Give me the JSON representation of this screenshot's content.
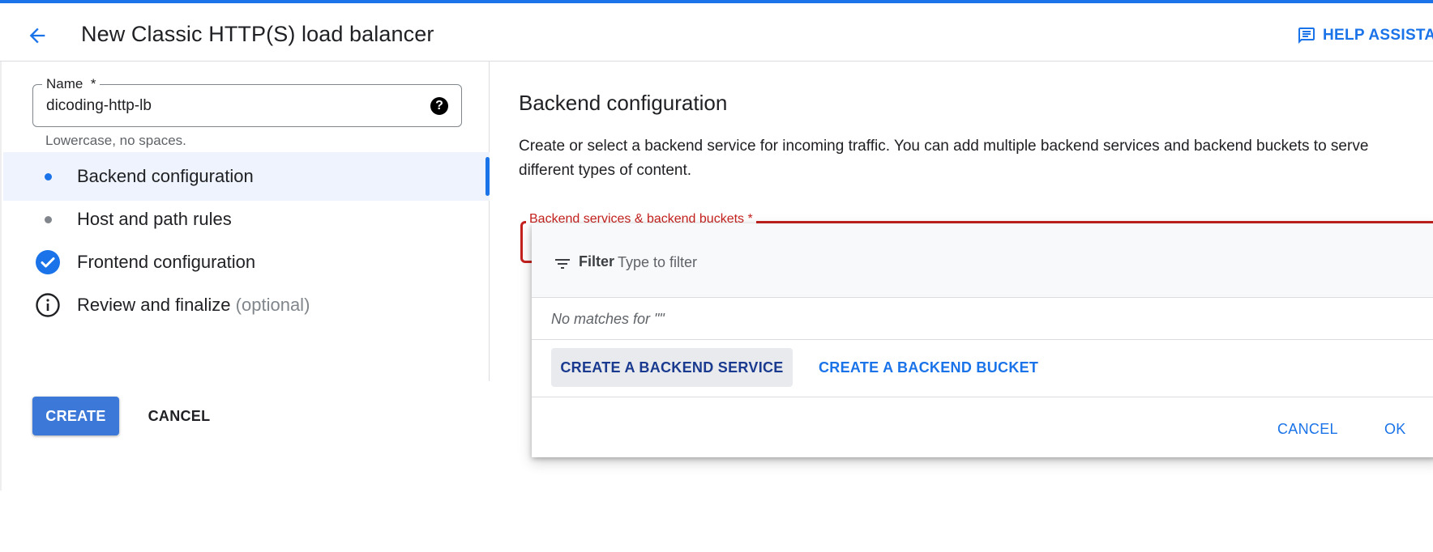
{
  "header": {
    "title": "New Classic HTTP(S) load balancer",
    "help_label": "HELP ASSISTANT"
  },
  "name_field": {
    "label": "Name",
    "required_mark": "*",
    "value": "dicoding-http-lb",
    "hint": "Lowercase, no spaces.",
    "help_glyph": "?"
  },
  "steps": [
    {
      "label": "Backend configuration",
      "state": "active",
      "icon": "dot-icon"
    },
    {
      "label": "Host and path rules",
      "state": "pending",
      "icon": "dot-icon"
    },
    {
      "label": "Frontend configuration",
      "state": "complete",
      "icon": "check-circle-icon"
    },
    {
      "label": "Review and finalize",
      "optional_text": "(optional)",
      "state": "info",
      "icon": "info-circle-icon"
    }
  ],
  "actions": {
    "create_label": "CREATE",
    "cancel_label": "CANCEL"
  },
  "backend_section": {
    "title": "Backend configuration",
    "description": "Create or select a backend service for incoming traffic. You can add multiple backend services and backend buckets to serve different types of content.",
    "field_label": "Backend services & backend buckets *"
  },
  "dropdown": {
    "filter_label": "Filter",
    "filter_placeholder": "Type to filter",
    "filter_value": "",
    "no_matches": "No matches for \"\"",
    "create_service_label": "CREATE A BACKEND SERVICE",
    "create_bucket_label": "CREATE A BACKEND BUCKET",
    "cancel_label": "CANCEL",
    "ok_label": "OK"
  },
  "colors": {
    "accent": "#1a73e8",
    "error": "#c5221f",
    "primary_button": "#3c78d8",
    "active_step_bg": "#eef3fd"
  }
}
